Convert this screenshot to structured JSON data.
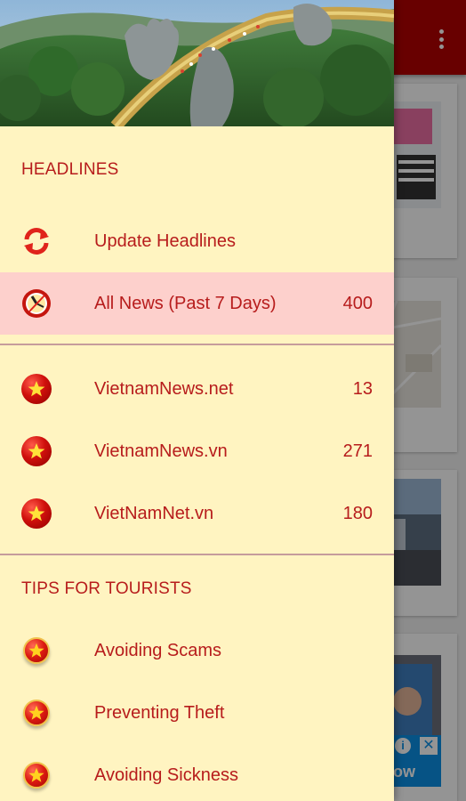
{
  "drawer": {
    "sections": [
      {
        "title": "HEADLINES",
        "items": [
          {
            "icon": "refresh-icon",
            "label": "Update Headlines",
            "count": ""
          },
          {
            "icon": "clock-icon",
            "label": "All News (Past 7 Days)",
            "count": "400",
            "active": true
          }
        ]
      },
      {
        "title": "",
        "items": [
          {
            "icon": "vietnam-flag-icon",
            "label": "VietnamNews.net",
            "count": "13"
          },
          {
            "icon": "vietnam-flag-icon",
            "label": "VietnamNews.vn",
            "count": "271"
          },
          {
            "icon": "vietnam-flag-icon",
            "label": "VietNamNet.vn",
            "count": "180"
          }
        ]
      },
      {
        "title": "TIPS FOR TOURISTS",
        "items": [
          {
            "icon": "star-badge-icon",
            "label": "Avoiding Scams",
            "count": ""
          },
          {
            "icon": "star-badge-icon",
            "label": "Preventing Theft",
            "count": ""
          },
          {
            "icon": "star-badge-icon",
            "label": "Avoiding Sickness",
            "count": ""
          }
        ]
      }
    ]
  },
  "app": {
    "ad": {
      "text": "ow",
      "close": "✕",
      "info": "i"
    }
  },
  "colors": {
    "app_bar": "#b30000",
    "drawer_bg": "#fff4c1",
    "text_accent": "#b71c1c",
    "active_bg": "#fdd0cc"
  }
}
